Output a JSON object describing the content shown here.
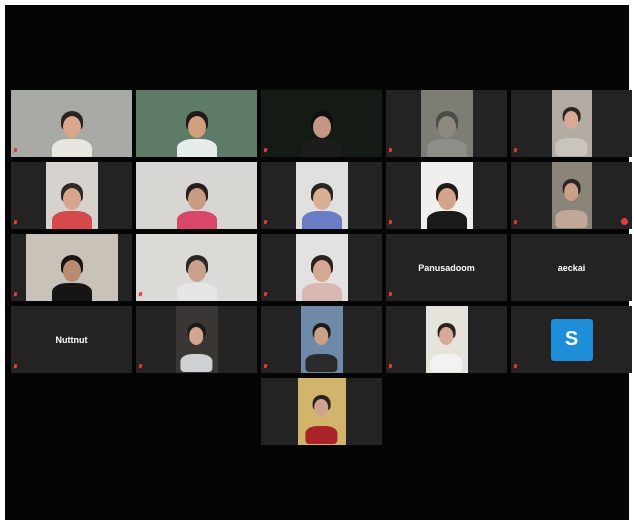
{
  "colors": {
    "window_bg": "#050505",
    "tile_bg": "#232323",
    "active_speaker_border": "#c9d63a",
    "muted_icon": "#e23b3b",
    "avatar_s": "#1e8ed8"
  },
  "tiles": [
    {
      "type": "video",
      "name": "",
      "muted": true,
      "bg": "#a8aaa6",
      "skin": "#d9a78e",
      "hair": "#2b2320",
      "shirt": "#e8e4de"
    },
    {
      "type": "video",
      "name": "",
      "muted": false,
      "speaking": true,
      "bg": "#5d7b67",
      "skin": "#d0a07c",
      "hair": "#1d1a18",
      "shirt": "#e6ecea"
    },
    {
      "type": "video",
      "name": "",
      "muted": true,
      "bg": "#141a14",
      "skin": "#c49782",
      "hair": "#0f0f0f",
      "shirt": "#1c1c1c"
    },
    {
      "type": "video",
      "name": "",
      "muted": true,
      "bg": "#7d7d76",
      "skin": "#8e8a80",
      "hair": "#4c4c48",
      "shirt": "#8e8e88"
    },
    {
      "type": "video",
      "name": "",
      "muted": true,
      "bg": "#b2aca2",
      "skin": "#d9aa93",
      "hair": "#2c2624",
      "shirt": "#c9c4bc"
    },
    {
      "type": "video",
      "name": "",
      "muted": true,
      "bg": "#d6d3ce",
      "skin": "#d6a58c",
      "hair": "#2f2824",
      "shirt": "#d44a4a"
    },
    {
      "type": "video",
      "name": "",
      "muted": false,
      "bg": "#d8d6d2",
      "skin": "#c99b80",
      "hair": "#251e1c",
      "shirt": "#d8476a"
    },
    {
      "type": "video",
      "name": "",
      "muted": true,
      "bg": "#e0e0de",
      "skin": "#d8ae97",
      "hair": "#2a2420",
      "shirt": "#6b7bc4"
    },
    {
      "type": "video",
      "name": "",
      "muted": true,
      "bg": "#f0efee",
      "skin": "#d2a58b",
      "hair": "#201b19",
      "shirt": "#1a1a1a"
    },
    {
      "type": "video",
      "name": "",
      "muted": true,
      "bg": "#8b8478",
      "skin": "#caa08a",
      "hair": "#2b2420",
      "shirt": "#bfa89a",
      "badge": true
    },
    {
      "type": "video",
      "name": "",
      "muted": true,
      "bg": "#c9c2b8",
      "skin": "#b88c70",
      "hair": "#1a1614",
      "shirt": "#151515"
    },
    {
      "type": "video",
      "name": "",
      "muted": true,
      "bg": "#dcdad6",
      "skin": "#c8a08c",
      "hair": "#2c2622",
      "shirt": "#e6e6e6"
    },
    {
      "type": "video",
      "name": "",
      "muted": true,
      "bg": "#e4e2e0",
      "skin": "#d4a892",
      "hair": "#2a2320",
      "shirt": "#d7b8b2"
    },
    {
      "type": "text",
      "label": "Panusadoom",
      "name": "",
      "muted": true
    },
    {
      "type": "text",
      "label": "aeckai",
      "name": "",
      "muted": false
    },
    {
      "type": "text",
      "label": "Nuttnut",
      "name": "",
      "muted": true
    },
    {
      "type": "video",
      "name": "",
      "muted": true,
      "bg": "#3a3634",
      "skin": "#d2a68e",
      "hair": "#1c1816",
      "shirt": "#cfd0d4"
    },
    {
      "type": "video",
      "name": "",
      "muted": true,
      "bg": "#6f8aa8",
      "skin": "#caa28a",
      "hair": "#1e1a18",
      "shirt": "#2a2a2a"
    },
    {
      "type": "video",
      "name": "",
      "muted": true,
      "bg": "#e6e2dc",
      "skin": "#d6ab95",
      "hair": "#2a2320",
      "shirt": "#f2f2f2"
    },
    {
      "type": "avatar",
      "letter": "S",
      "name": "",
      "muted": true
    },
    {
      "type": "video",
      "name": "",
      "muted": false,
      "bg": "#d2b46a",
      "skin": "#d0a48c",
      "hair": "#2a2420",
      "shirt": "#a8232a"
    }
  ]
}
